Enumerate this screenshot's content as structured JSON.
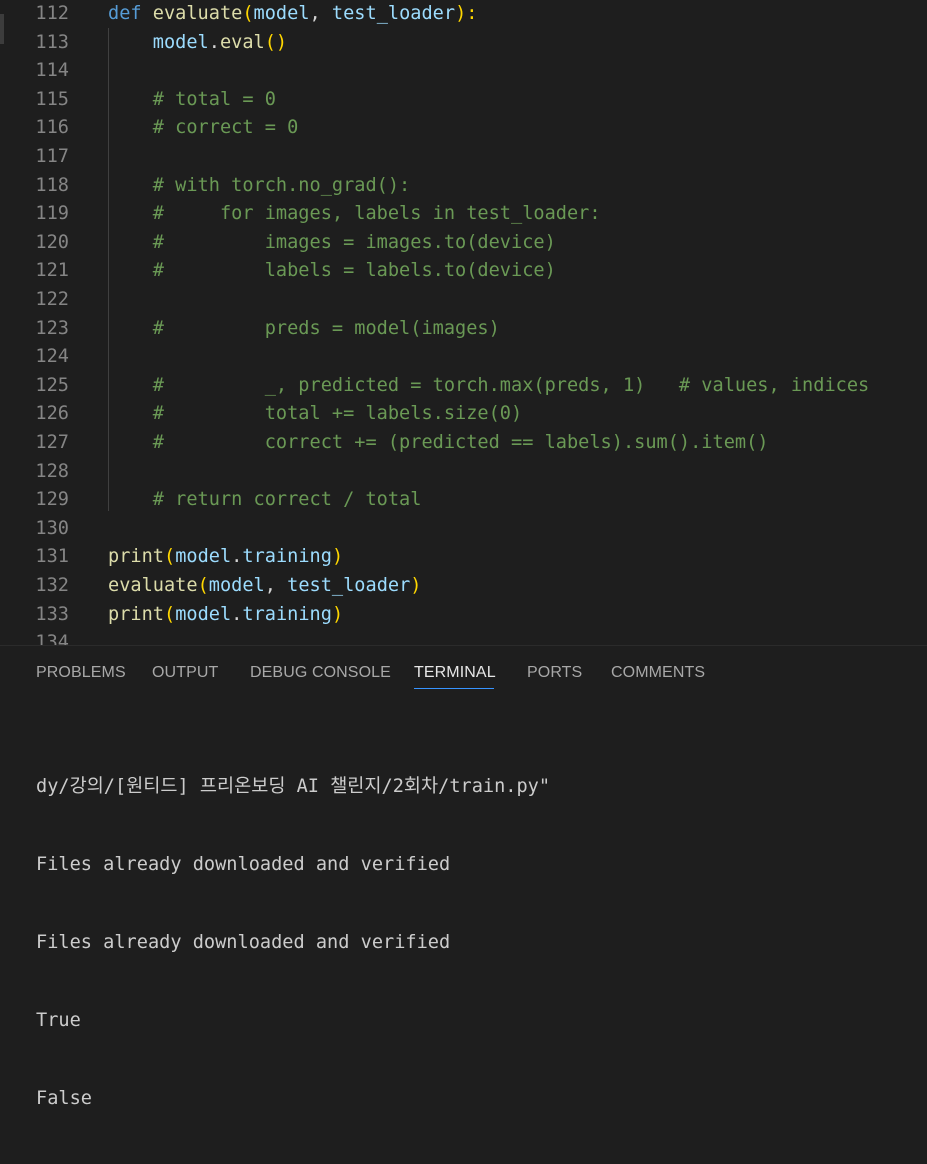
{
  "editor": {
    "lines": [
      {
        "n": "112",
        "parts": [
          {
            "t": "def ",
            "c": "kw"
          },
          {
            "t": "evaluate",
            "c": "fn"
          },
          {
            "t": "(",
            "c": "br"
          },
          {
            "t": "model",
            "c": "var"
          },
          {
            "t": ", ",
            "c": "txt"
          },
          {
            "t": "test_loader",
            "c": "var"
          },
          {
            "t": "):",
            "c": "br"
          }
        ]
      },
      {
        "n": "113",
        "parts": [
          {
            "t": "    model",
            "c": "var"
          },
          {
            "t": ".",
            "c": "txt"
          },
          {
            "t": "eval",
            "c": "fn"
          },
          {
            "t": "()",
            "c": "br"
          }
        ]
      },
      {
        "n": "114",
        "parts": []
      },
      {
        "n": "115",
        "parts": [
          {
            "t": "    # total = 0",
            "c": "cm"
          }
        ]
      },
      {
        "n": "116",
        "parts": [
          {
            "t": "    # correct = 0",
            "c": "cm"
          }
        ]
      },
      {
        "n": "117",
        "parts": []
      },
      {
        "n": "118",
        "parts": [
          {
            "t": "    # with torch.no_grad():",
            "c": "cm"
          }
        ]
      },
      {
        "n": "119",
        "parts": [
          {
            "t": "    #     for images, labels in test_loader:",
            "c": "cm"
          }
        ]
      },
      {
        "n": "120",
        "parts": [
          {
            "t": "    #         images = images.to(device)",
            "c": "cm"
          }
        ]
      },
      {
        "n": "121",
        "parts": [
          {
            "t": "    #         labels = labels.to(device)",
            "c": "cm"
          }
        ]
      },
      {
        "n": "122",
        "parts": []
      },
      {
        "n": "123",
        "parts": [
          {
            "t": "    #         preds = model(images)",
            "c": "cm"
          }
        ]
      },
      {
        "n": "124",
        "parts": []
      },
      {
        "n": "125",
        "parts": [
          {
            "t": "    #         _, predicted = torch.max(preds, 1)   # values, indices",
            "c": "cm"
          }
        ]
      },
      {
        "n": "126",
        "parts": [
          {
            "t": "    #         total += labels.size(0)",
            "c": "cm"
          }
        ]
      },
      {
        "n": "127",
        "parts": [
          {
            "t": "    #         correct += (predicted == labels).sum().item()",
            "c": "cm"
          }
        ]
      },
      {
        "n": "128",
        "parts": []
      },
      {
        "n": "129",
        "parts": [
          {
            "t": "    # return correct / total",
            "c": "cm"
          }
        ]
      },
      {
        "n": "130",
        "parts": []
      },
      {
        "n": "131",
        "parts": [
          {
            "t": "print",
            "c": "fn"
          },
          {
            "t": "(",
            "c": "br"
          },
          {
            "t": "model",
            "c": "var"
          },
          {
            "t": ".",
            "c": "txt"
          },
          {
            "t": "training",
            "c": "var"
          },
          {
            "t": ")",
            "c": "br"
          }
        ]
      },
      {
        "n": "132",
        "parts": [
          {
            "t": "evaluate",
            "c": "fn"
          },
          {
            "t": "(",
            "c": "br"
          },
          {
            "t": "model",
            "c": "var"
          },
          {
            "t": ", ",
            "c": "txt"
          },
          {
            "t": "test_loader",
            "c": "var"
          },
          {
            "t": ")",
            "c": "br"
          }
        ]
      },
      {
        "n": "133",
        "parts": [
          {
            "t": "print",
            "c": "fn"
          },
          {
            "t": "(",
            "c": "br"
          },
          {
            "t": "model",
            "c": "var"
          },
          {
            "t": ".",
            "c": "txt"
          },
          {
            "t": "training",
            "c": "var"
          },
          {
            "t": ")",
            "c": "br"
          }
        ]
      },
      {
        "n": "134",
        "parts": []
      }
    ]
  },
  "panel": {
    "tabs": [
      "PROBLEMS",
      "OUTPUT",
      "DEBUG CONSOLE",
      "TERMINAL",
      "PORTS",
      "COMMENTS"
    ],
    "active_tab": "TERMINAL"
  },
  "terminal": {
    "lines": [
      "dy/강의/[원티드] 프리온보딩 AI 챌린지/2회차/train.py\"",
      "Files already downloaded and verified",
      "Files already downloaded and verified",
      "True",
      "False"
    ]
  }
}
